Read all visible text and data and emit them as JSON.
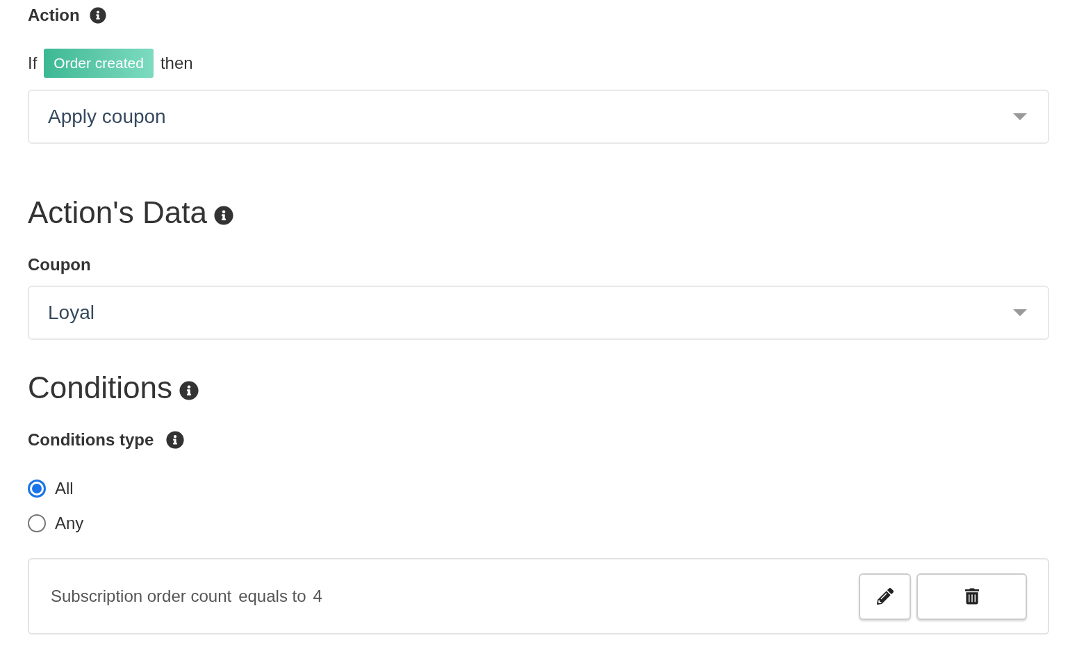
{
  "action": {
    "label": "Action",
    "trigger_prefix": "If",
    "trigger": "Order created",
    "trigger_suffix": "then",
    "select": {
      "value": "Apply coupon"
    }
  },
  "actions_data": {
    "heading": "Action's Data",
    "coupon": {
      "label": "Coupon",
      "value": "Loyal"
    }
  },
  "conditions": {
    "heading": "Conditions",
    "type_label": "Conditions type",
    "options": [
      {
        "label": "All",
        "selected": true
      },
      {
        "label": "Any",
        "selected": false
      }
    ],
    "items": [
      {
        "field": "Subscription order count",
        "operator": "equals to",
        "value": "4"
      }
    ]
  }
}
